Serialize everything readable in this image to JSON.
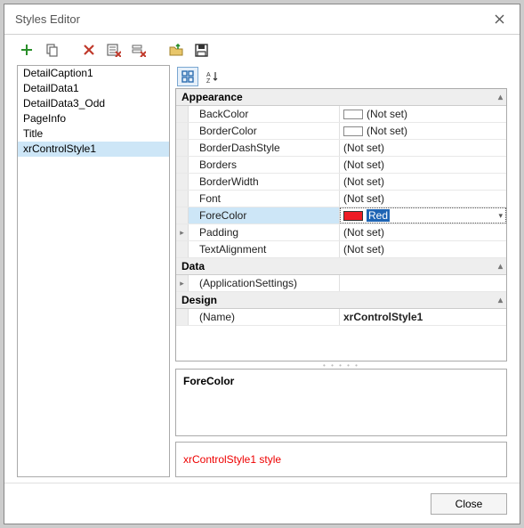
{
  "window": {
    "title": "Styles Editor"
  },
  "buttons": {
    "close": "Close"
  },
  "styles": [
    {
      "name": "DetailCaption1",
      "selected": false
    },
    {
      "name": "DetailData1",
      "selected": false
    },
    {
      "name": "DetailData3_Odd",
      "selected": false
    },
    {
      "name": "PageInfo",
      "selected": false
    },
    {
      "name": "Title",
      "selected": false
    },
    {
      "name": "xrControlStyle1",
      "selected": true
    }
  ],
  "categories": {
    "appearance": {
      "label": "Appearance"
    },
    "data": {
      "label": "Data"
    },
    "design": {
      "label": "Design"
    }
  },
  "props": {
    "backcolor": {
      "label": "BackColor",
      "value": "(Not set)",
      "swatch": "white"
    },
    "bordercolor": {
      "label": "BorderColor",
      "value": "(Not set)",
      "swatch": "white"
    },
    "borderdash": {
      "label": "BorderDashStyle",
      "value": "(Not set)"
    },
    "borders": {
      "label": "Borders",
      "value": "(Not set)"
    },
    "borderwidth": {
      "label": "BorderWidth",
      "value": "(Not set)"
    },
    "font": {
      "label": "Font",
      "value": "(Not set)"
    },
    "forecolor": {
      "label": "ForeColor",
      "value": "Red",
      "swatch": "red"
    },
    "padding": {
      "label": "Padding",
      "value": "(Not set)"
    },
    "textalign": {
      "label": "TextAlignment",
      "value": "(Not set)"
    },
    "appsettings": {
      "label": "(ApplicationSettings)",
      "value": ""
    },
    "name": {
      "label": "(Name)",
      "value": "xrControlStyle1"
    }
  },
  "desc": {
    "title": "ForeColor",
    "body": ""
  },
  "preview": {
    "text": "xrControlStyle1 style"
  }
}
